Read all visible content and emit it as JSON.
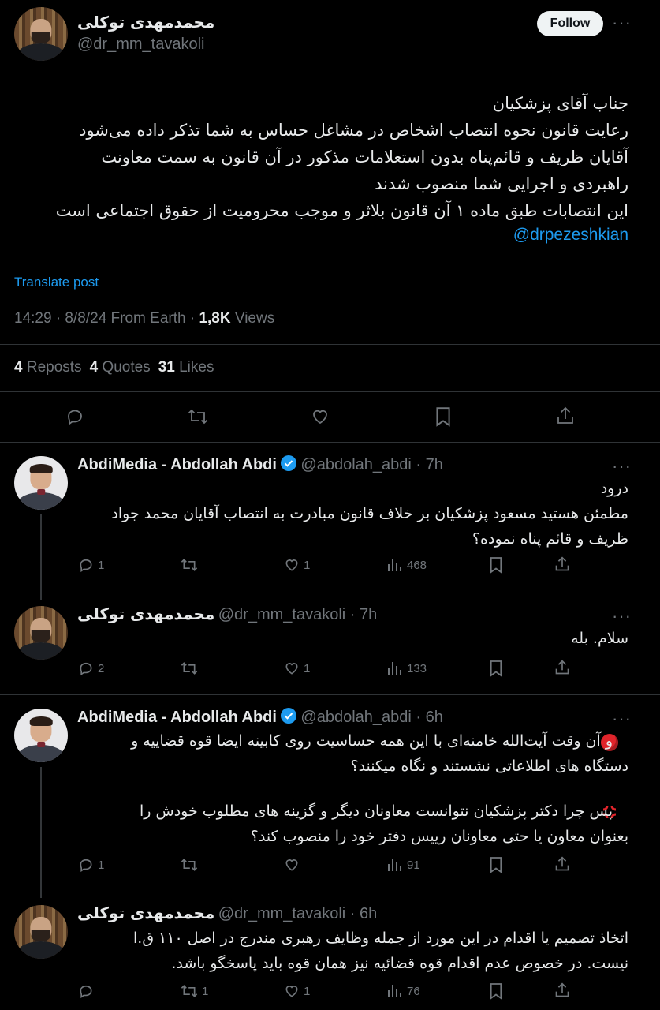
{
  "main": {
    "author_name": "محمدمهدی توکلی",
    "author_handle": "@dr_mm_tavakoli",
    "follow_label": "Follow",
    "more_icon": "more-dots-icon",
    "lines": [
      "جناب آقای پزشکیان",
      "رعایت قانون نحوه انتصاب اشخاص در مشاغل حساس به شما تذکر داده می‌شود",
      "آقایان ظریف و قائم‌پناه بدون استعلامات مذکور در آن قانون به سمت معاونت",
      "راهبردی و اجرایی شما منصوب شدند",
      "این انتصابات طبق ماده ۱ آن قانون بلاثر و موجب محرومیت از حقوق اجتماعی است"
    ],
    "mention": "@drpezeshkian",
    "translate_label": "Translate post",
    "meta": {
      "time_date": "14:29 · 8/8/24 From Earth · ",
      "views_count": "1,8K",
      "views_label": " Views"
    },
    "stats": {
      "reposts_count": "4",
      "reposts_label": " Reposts",
      "quotes_count": "4",
      "quotes_label": " Quotes",
      "likes_count": "31",
      "likes_label": " Likes"
    }
  },
  "replies": [
    {
      "name": "AbdiMedia - Abdollah Abdi",
      "handle_time": "@abdolah_abdi · 7h",
      "lines": [
        "درود",
        "مطمئن هستید مسعود پزشکیان بر خلاف قانون مبادرت به انتصاب آقایان محمد جواد",
        "ظریف و قائم پناه نموده؟"
      ],
      "replies_count": "1",
      "reposts_count": "",
      "likes_count": "1",
      "views_count": "468"
    },
    {
      "name": "محمدمهدی توکلی",
      "handle_time": "@dr_mm_tavakoli · 7h",
      "lines": [
        "سلام. بله"
      ],
      "replies_count": "2",
      "reposts_count": "",
      "likes_count": "1",
      "views_count": "133"
    },
    {
      "name": "AbdiMedia - Abdollah Abdi",
      "handle_time": "@abdolah_abdi · 6h",
      "lines": [
        "و آن وقت آیت‌الله خامنه‌ای با این همه حساسیت روی کابینه ایضا قوه قضاییه و",
        "دستگاه های اطلاعاتی نشستند و نگاه میکنند؟",
        "پس چرا دکتر پزشکیان نتوانست معاونان دیگر و گزینه های مطلوب خودش را",
        "بعنوان معاون یا حتی معاونان رییس دفتر خود را منصوب کند؟"
      ],
      "emoji_1": "red-circle-icon",
      "emoji_2": "anger-symbol-icon",
      "replies_count": "1",
      "reposts_count": "",
      "likes_count": "",
      "views_count": "91"
    },
    {
      "name": "محمدمهدی توکلی",
      "handle_time": "@dr_mm_tavakoli · 6h",
      "lines": [
        "اتخاذ تصمیم یا اقدام در این مورد از جمله وظایف رهبری مندرج در اصل ۱۱۰ ق.ا",
        "نیست. در خصوص عدم اقدام قوه قضائیه نیز همان قوه باید پاسخگو باشد."
      ],
      "replies_count": "",
      "reposts_count": "1",
      "likes_count": "1",
      "views_count": "76"
    }
  ],
  "colors": {
    "background": "#000000",
    "text": "#e7e9ea",
    "secondary": "#71767b",
    "accent": "#1d9bf0",
    "divider": "#2f3336"
  }
}
